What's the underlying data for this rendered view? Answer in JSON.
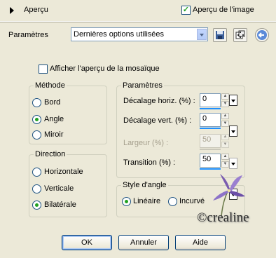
{
  "header": {
    "preview_label": "Aperçu",
    "image_preview_label": "Aperçu de l'image",
    "image_preview_checked": true
  },
  "settings": {
    "label": "Paramètres",
    "preset_value": "Dernières options utilisées"
  },
  "mosaic_preview_label": "Afficher l'aperçu de la mosaïque",
  "method": {
    "title": "Méthode",
    "options": [
      "Bord",
      "Angle",
      "Miroir"
    ],
    "selected": "Angle"
  },
  "direction": {
    "title": "Direction",
    "options": [
      "Horizontale",
      "Verticale",
      "Bilatérale"
    ],
    "selected": "Bilatérale"
  },
  "params": {
    "title": "Paramètres",
    "h_offset_label": "Décalage horiz. (%) :",
    "h_offset_value": "0",
    "v_offset_label": "Décalage vert. (%) :",
    "v_offset_value": "0",
    "width_label": "Largeur (%) :",
    "width_value": "50",
    "transition_label": "Transition (%) :",
    "transition_value": "50"
  },
  "corner_style": {
    "title": "Style d'angle",
    "options": [
      "Linéaire",
      "Incurvé"
    ],
    "selected": "Linéaire"
  },
  "watermark": "©crealine",
  "buttons": {
    "ok": "OK",
    "cancel": "Annuler",
    "help": "Aide"
  }
}
